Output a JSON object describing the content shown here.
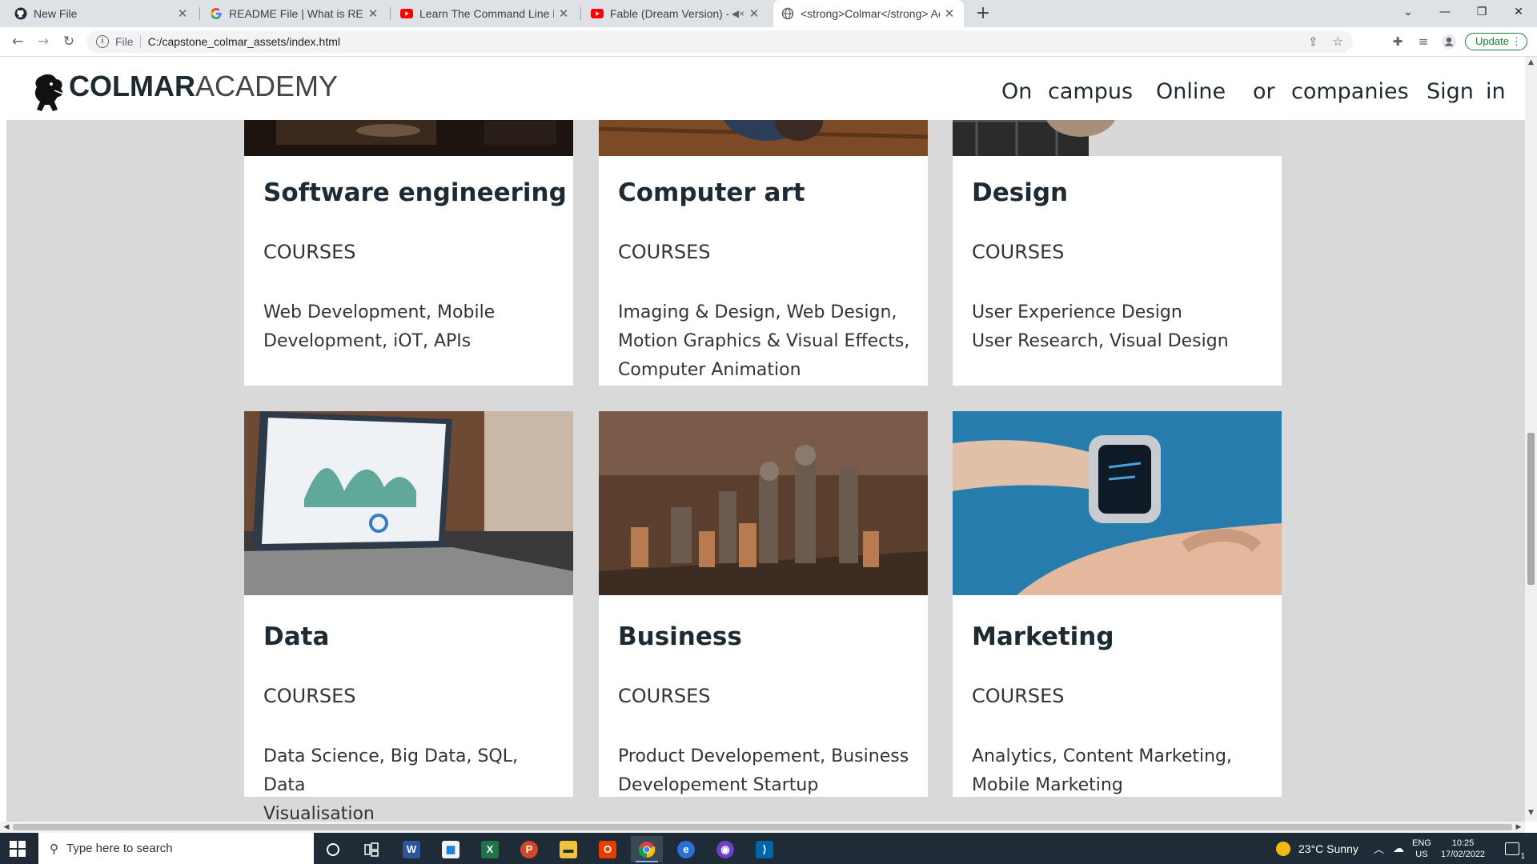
{
  "browser": {
    "tabs": [
      {
        "title": "New File",
        "icon": "github-icon"
      },
      {
        "title": "README File | What is README & ",
        "icon": "google-icon"
      },
      {
        "title": "Learn The Command Line Excursi",
        "icon": "youtube-icon"
      },
      {
        "title": "Fable (Dream Version) - YouT",
        "icon": "youtube-icon"
      },
      {
        "title": "<strong>Colmar</strong> Acad",
        "icon": "globe-icon"
      }
    ],
    "scheme": "File",
    "url": "C:/capstone_colmar_assets/index.html",
    "update_label": "Update"
  },
  "site": {
    "logo_bold": "COLMAR",
    "logo_regular": "ACADEMY",
    "nav": [
      "On",
      "campus",
      "Online",
      "or",
      "companies",
      "Sign",
      "in"
    ]
  },
  "cards": [
    {
      "title": "Software engineering",
      "courses_label": "COURSES",
      "list_lines": [
        "Web Development, Mobile",
        "Development, iOT, APIs"
      ]
    },
    {
      "title": "Computer art",
      "courses_label": "COURSES",
      "list_lines": [
        "Imaging & Design, Web Design,",
        "Motion Graphics & Visual Effects,",
        "Computer Animation"
      ]
    },
    {
      "title": "Design",
      "courses_label": "COURSES",
      "list_lines": [
        "User Experience Design",
        "User Research, Visual Design"
      ]
    },
    {
      "title": "Data",
      "courses_label": "COURSES",
      "list_lines": [
        "Data Science, Big Data, SQL, Data",
        "Visualisation"
      ]
    },
    {
      "title": "Business",
      "courses_label": "COURSES",
      "list_lines": [
        "Product Developement, Business",
        "Developement Startup"
      ]
    },
    {
      "title": "Marketing",
      "courses_label": "COURSES",
      "list_lines": [
        "Analytics, Content Marketing,",
        "Mobile Marketing"
      ]
    }
  ],
  "taskbar": {
    "search_placeholder": "Type here to search",
    "weather": "23°C  Sunny",
    "lang_top": "ENG",
    "lang_bottom": "US",
    "time": "10:25",
    "date": "17/02/2022",
    "notification_count": "1"
  }
}
